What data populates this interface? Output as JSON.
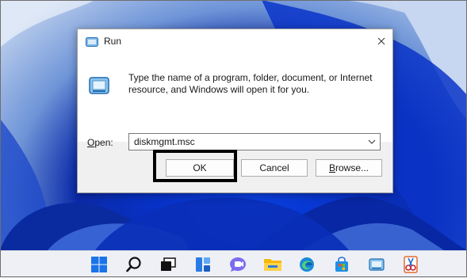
{
  "dialog": {
    "title": "Run",
    "description": "Type the name of a program, folder, document, or Internet resource, and Windows will open it for you.",
    "open_label_accel": "O",
    "open_label_rest": "pen:",
    "open_value": "diskmgmt.msc",
    "ok_label": "OK",
    "cancel_label": "Cancel",
    "browse_label_accel": "B",
    "browse_label_rest": "rowse..."
  },
  "taskbar": {
    "icons": [
      "windows-start-icon",
      "search-icon",
      "task-view-icon",
      "widgets-icon",
      "teams-chat-icon",
      "file-explorer-icon",
      "edge-icon",
      "store-icon",
      "run-icon",
      "snipping-tool-icon"
    ]
  },
  "colors": {
    "accent": "#0a3fe0",
    "taskbar": "#eef0f6",
    "highlight_box": "#000000"
  }
}
